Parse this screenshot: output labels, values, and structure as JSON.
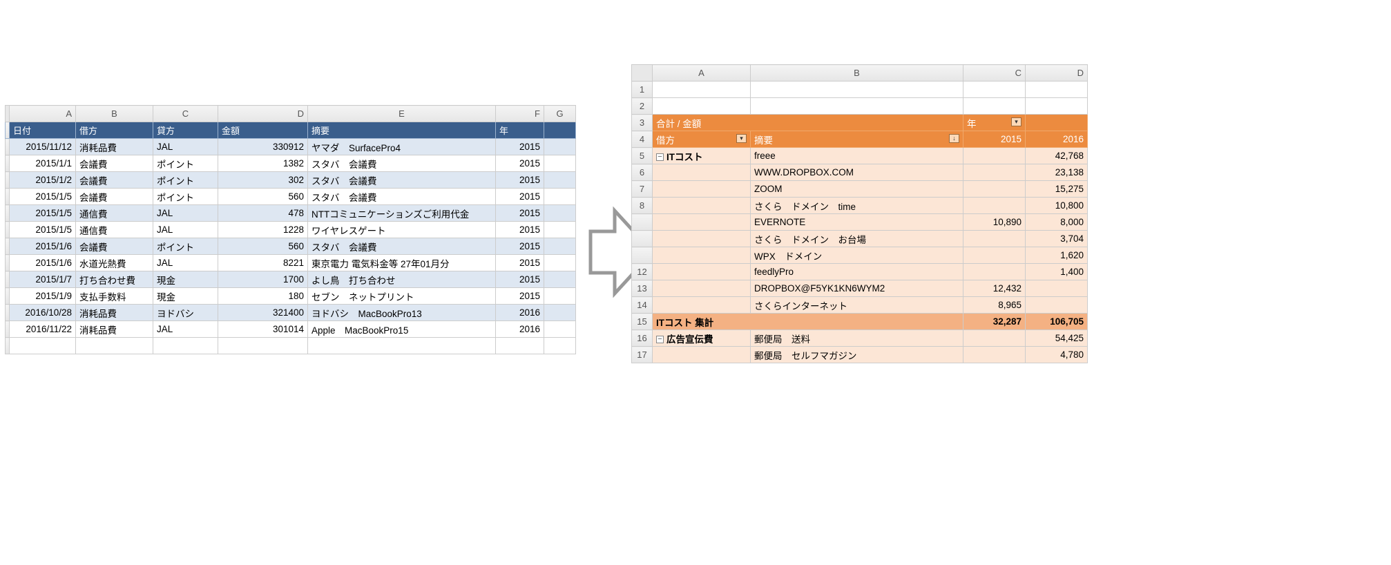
{
  "left": {
    "cols": [
      "A",
      "B",
      "C",
      "D",
      "E",
      "F",
      "G"
    ],
    "headers": {
      "A": "日付",
      "B": "借方",
      "C": "貸方",
      "D": "金額",
      "E": "摘要",
      "F": "年"
    },
    "rows": [
      {
        "A": "2015/11/12",
        "B": "消耗品費",
        "C": "JAL",
        "D": "330912",
        "E": "ヤマダ　SurfacePro4",
        "F": "2015"
      },
      {
        "A": "2015/1/1",
        "B": "会議費",
        "C": "ポイント",
        "D": "1382",
        "E": "スタバ　会議費",
        "F": "2015"
      },
      {
        "A": "2015/1/2",
        "B": "会議費",
        "C": "ポイント",
        "D": "302",
        "E": "スタバ　会議費",
        "F": "2015"
      },
      {
        "A": "2015/1/5",
        "B": "会議費",
        "C": "ポイント",
        "D": "560",
        "E": "スタバ　会議費",
        "F": "2015"
      },
      {
        "A": "2015/1/5",
        "B": "通信費",
        "C": "JAL",
        "D": "478",
        "E": "NTTコミュニケーションズご利用代金",
        "F": "2015"
      },
      {
        "A": "2015/1/5",
        "B": "通信費",
        "C": "JAL",
        "D": "1228",
        "E": "ワイヤレスゲート",
        "F": "2015"
      },
      {
        "A": "2015/1/6",
        "B": "会議費",
        "C": "ポイント",
        "D": "560",
        "E": "スタバ　会議費",
        "F": "2015"
      },
      {
        "A": "2015/1/6",
        "B": "水道光熱費",
        "C": "JAL",
        "D": "8221",
        "E": "東京電力 電気料金等 27年01月分",
        "F": "2015"
      },
      {
        "A": "2015/1/7",
        "B": "打ち合わせ費",
        "C": "現金",
        "D": "1700",
        "E": "よし鳥　打ち合わせ",
        "F": "2015"
      },
      {
        "A": "2015/1/9",
        "B": "支払手数料",
        "C": "現金",
        "D": "180",
        "E": "セブン　ネットプリント",
        "F": "2015"
      },
      {
        "A": "2016/10/28",
        "B": "消耗品費",
        "C": "ヨドバシ",
        "D": "321400",
        "E": "ヨドバシ　MacBookPro13",
        "F": "2016"
      },
      {
        "A": "2016/11/22",
        "B": "消耗品費",
        "C": "JAL",
        "D": "301014",
        "E": "Apple　MacBookPro15",
        "F": "2016"
      }
    ]
  },
  "right": {
    "cols": [
      "A",
      "B",
      "C",
      "D"
    ],
    "row_nums": [
      "1",
      "2",
      "3",
      "4",
      "5",
      "6",
      "7",
      "8",
      "",
      "",
      "",
      "12",
      "13",
      "14",
      "15",
      "16",
      "17"
    ],
    "r3": {
      "A": "合計 / 金額",
      "C": "年"
    },
    "r4": {
      "A": "借方",
      "B": "摘要",
      "C": "2015",
      "D": "2016"
    },
    "rows": [
      {
        "n": "5",
        "cat": "ITコスト",
        "B": "freee",
        "C": "",
        "D": "42,768"
      },
      {
        "n": "6",
        "B": "WWW.DROPBOX.COM",
        "C": "",
        "D": "23,138"
      },
      {
        "n": "7",
        "B": "ZOOM",
        "C": "",
        "D": "15,275"
      },
      {
        "n": "8",
        "B": "さくら　ドメイン　time",
        "C": "",
        "D": "10,800"
      },
      {
        "n": "",
        "B": "EVERNOTE",
        "C": "10,890",
        "D": "8,000"
      },
      {
        "n": "",
        "B": "さくら　ドメイン　お台場",
        "C": "",
        "D": "3,704"
      },
      {
        "n": "",
        "B": "WPX　ドメイン",
        "C": "",
        "D": "1,620"
      },
      {
        "n": "12",
        "B": "feedlyPro",
        "C": "",
        "D": "1,400"
      },
      {
        "n": "13",
        "B": "DROPBOX@F5YK1KN6WYM2",
        "C": "12,432",
        "D": ""
      },
      {
        "n": "14",
        "B": "さくらインターネット",
        "C": "8,965",
        "D": ""
      }
    ],
    "subtotal": {
      "n": "15",
      "A": "ITコスト 集計",
      "C": "32,287",
      "D": "106,705"
    },
    "rows2": [
      {
        "n": "16",
        "cat": "広告宣伝費",
        "B": "郵便局　送料",
        "C": "",
        "D": "54,425"
      },
      {
        "n": "17",
        "B": "郵便局　セルフマガジン",
        "C": "",
        "D": "4,780"
      }
    ]
  }
}
